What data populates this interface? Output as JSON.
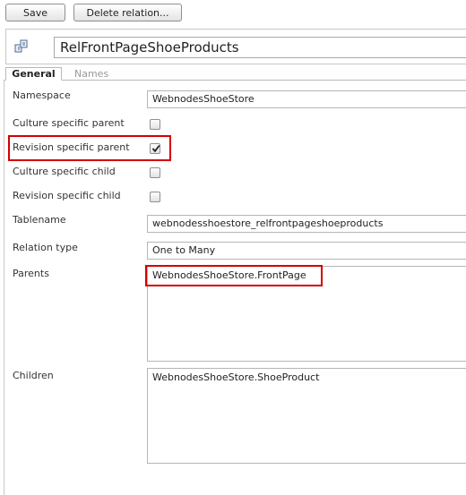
{
  "toolbar": {
    "save_label": "Save",
    "delete_label": "Delete relation..."
  },
  "header": {
    "name_value": "RelFrontPageShoeProducts",
    "icon": "relation-icon"
  },
  "tabs": [
    {
      "label": "General",
      "active": true
    },
    {
      "label": "Names",
      "active": false
    }
  ],
  "form": {
    "namespace": {
      "label": "Namespace",
      "value": "WebnodesShoeStore"
    },
    "culture_specific_parent": {
      "label": "Culture specific parent",
      "checked": false
    },
    "revision_specific_parent": {
      "label": "Revision specific parent",
      "checked": true
    },
    "culture_specific_child": {
      "label": "Culture specific child",
      "checked": false
    },
    "revision_specific_child": {
      "label": "Revision specific child",
      "checked": false
    },
    "tablename": {
      "label": "Tablename",
      "value": "webnodesshoestore_relfrontpageshoeproducts"
    },
    "relation_type": {
      "label": "Relation type",
      "value": "One to Many"
    },
    "parents": {
      "label": "Parents",
      "value": "WebnodesShoeStore.FrontPage"
    },
    "children": {
      "label": "Children",
      "value": "WebnodesShoeStore.ShoeProduct"
    }
  },
  "colors": {
    "highlight": "#d40000",
    "border": "#b5b5b5"
  }
}
